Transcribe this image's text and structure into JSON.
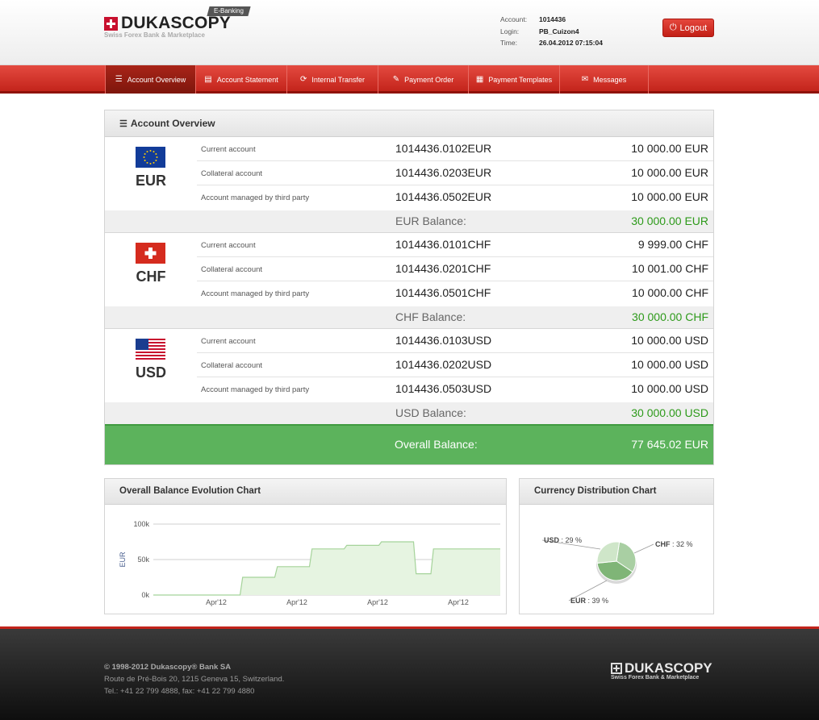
{
  "header": {
    "logo_text": "DUKASCOPY",
    "logo_sub": "Swiss Forex Bank & Marketplace",
    "tag": "E-Banking",
    "account_label": "Account:",
    "account_value": "1014436",
    "login_label": "Login:",
    "login_value": "PB_Cuizon4",
    "time_label": "Time:",
    "time_value": "26.04.2012 07:15:04",
    "logout_label": "Logout"
  },
  "nav": [
    {
      "label": "Account Overview",
      "icon": "list-icon"
    },
    {
      "label": "Account Statement",
      "icon": "document-icon"
    },
    {
      "label": "Internal Transfer",
      "icon": "refresh-icon"
    },
    {
      "label": "Payment Order",
      "icon": "edit-icon"
    },
    {
      "label": "Payment Templates",
      "icon": "template-icon"
    },
    {
      "label": "Messages",
      "icon": "envelope-icon"
    }
  ],
  "overview": {
    "title": "Account Overview",
    "currencies": [
      {
        "code": "EUR",
        "flag": "eu-flag-icon",
        "accounts": [
          {
            "type": "Current account",
            "number": "1014436.0102EUR",
            "amount": "10 000.00 EUR"
          },
          {
            "type": "Collateral account",
            "number": "1014436.0203EUR",
            "amount": "10 000.00 EUR"
          },
          {
            "type": "Account managed by third party",
            "number": "1014436.0502EUR",
            "amount": "10 000.00 EUR"
          }
        ],
        "balance_label": "EUR Balance:",
        "balance": "30 000.00 EUR"
      },
      {
        "code": "CHF",
        "flag": "swiss-flag-icon",
        "accounts": [
          {
            "type": "Current account",
            "number": "1014436.0101CHF",
            "amount": "9 999.00 CHF"
          },
          {
            "type": "Collateral account",
            "number": "1014436.0201CHF",
            "amount": "10 001.00 CHF"
          },
          {
            "type": "Account managed by third party",
            "number": "1014436.0501CHF",
            "amount": "10 000.00 CHF"
          }
        ],
        "balance_label": "CHF Balance:",
        "balance": "30 000.00 CHF"
      },
      {
        "code": "USD",
        "flag": "us-flag-icon",
        "accounts": [
          {
            "type": "Current account",
            "number": "1014436.0103USD",
            "amount": "10 000.00 USD"
          },
          {
            "type": "Collateral account",
            "number": "1014436.0202USD",
            "amount": "10 000.00 USD"
          },
          {
            "type": "Account managed by third party",
            "number": "1014436.0503USD",
            "amount": "10 000.00 USD"
          }
        ],
        "balance_label": "USD Balance:",
        "balance": "30 000.00 USD"
      }
    ],
    "overall_label": "Overall Balance:",
    "overall_value": "77 645.02 EUR"
  },
  "colors": {
    "brand_red": "#c8102e",
    "balance_green": "#2d9a1a",
    "overall_green": "#5cb35c"
  },
  "chart_data": [
    {
      "type": "area",
      "title": "Overall Balance Evolution Chart",
      "ylabel": "EUR",
      "ylim": [
        0,
        100000
      ],
      "yticks": [
        "100k",
        "50k",
        "0k"
      ],
      "xticks": [
        "Apr'12",
        "Apr'12",
        "Apr'12",
        "Apr'12"
      ],
      "grid": true,
      "legend": "none",
      "series": [
        {
          "values": [
            0,
            0,
            0,
            0,
            0,
            25000,
            25000,
            40000,
            40000,
            65000,
            65000,
            70000,
            70000,
            75000,
            75000,
            30000,
            65000,
            65000,
            65000,
            65000
          ]
        }
      ]
    },
    {
      "type": "pie",
      "title": "Currency Distribution Chart",
      "slices": [
        {
          "label": "CHF",
          "pct_label": " : 32 %",
          "value": 32,
          "color": "#a9cfa3"
        },
        {
          "label": "EUR",
          "pct_label": " : 39 %",
          "value": 39,
          "color": "#7fb577"
        },
        {
          "label": "USD",
          "pct_label": " : 29 %",
          "value": 29,
          "color": "#cfe6c9"
        }
      ]
    }
  ],
  "footer": {
    "copyright": "© 1998-2012 Dukascopy® Bank SA",
    "address": "Route de Pré-Bois 20, 1215 Geneva 15, Switzerland.",
    "phone": "Tel.: +41 22 799 4888, fax: +41 22 799 4880",
    "logo_text": "DUKASCOPY",
    "logo_sub": "Swiss Forex Bank & Marketplace"
  }
}
